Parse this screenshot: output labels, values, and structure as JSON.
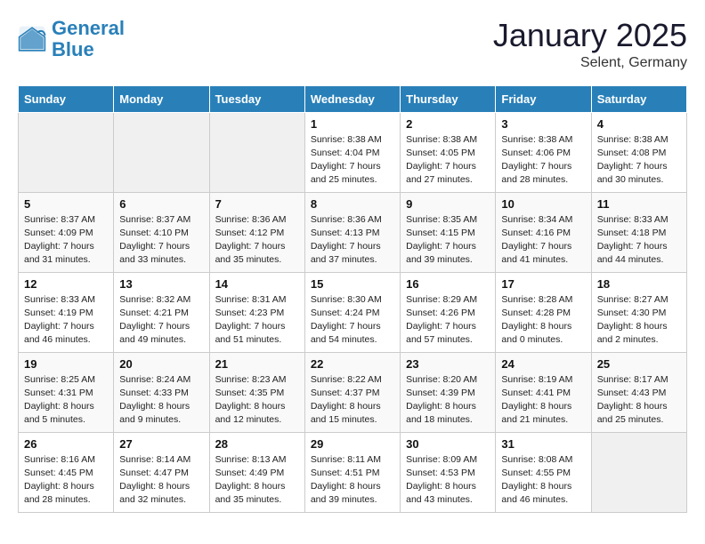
{
  "header": {
    "logo_general": "General",
    "logo_blue": "Blue",
    "title": "January 2025",
    "subtitle": "Selent, Germany"
  },
  "weekdays": [
    "Sunday",
    "Monday",
    "Tuesday",
    "Wednesday",
    "Thursday",
    "Friday",
    "Saturday"
  ],
  "weeks": [
    [
      {
        "day": "",
        "info": ""
      },
      {
        "day": "",
        "info": ""
      },
      {
        "day": "",
        "info": ""
      },
      {
        "day": "1",
        "info": "Sunrise: 8:38 AM\nSunset: 4:04 PM\nDaylight: 7 hours\nand 25 minutes."
      },
      {
        "day": "2",
        "info": "Sunrise: 8:38 AM\nSunset: 4:05 PM\nDaylight: 7 hours\nand 27 minutes."
      },
      {
        "day": "3",
        "info": "Sunrise: 8:38 AM\nSunset: 4:06 PM\nDaylight: 7 hours\nand 28 minutes."
      },
      {
        "day": "4",
        "info": "Sunrise: 8:38 AM\nSunset: 4:08 PM\nDaylight: 7 hours\nand 30 minutes."
      }
    ],
    [
      {
        "day": "5",
        "info": "Sunrise: 8:37 AM\nSunset: 4:09 PM\nDaylight: 7 hours\nand 31 minutes."
      },
      {
        "day": "6",
        "info": "Sunrise: 8:37 AM\nSunset: 4:10 PM\nDaylight: 7 hours\nand 33 minutes."
      },
      {
        "day": "7",
        "info": "Sunrise: 8:36 AM\nSunset: 4:12 PM\nDaylight: 7 hours\nand 35 minutes."
      },
      {
        "day": "8",
        "info": "Sunrise: 8:36 AM\nSunset: 4:13 PM\nDaylight: 7 hours\nand 37 minutes."
      },
      {
        "day": "9",
        "info": "Sunrise: 8:35 AM\nSunset: 4:15 PM\nDaylight: 7 hours\nand 39 minutes."
      },
      {
        "day": "10",
        "info": "Sunrise: 8:34 AM\nSunset: 4:16 PM\nDaylight: 7 hours\nand 41 minutes."
      },
      {
        "day": "11",
        "info": "Sunrise: 8:33 AM\nSunset: 4:18 PM\nDaylight: 7 hours\nand 44 minutes."
      }
    ],
    [
      {
        "day": "12",
        "info": "Sunrise: 8:33 AM\nSunset: 4:19 PM\nDaylight: 7 hours\nand 46 minutes."
      },
      {
        "day": "13",
        "info": "Sunrise: 8:32 AM\nSunset: 4:21 PM\nDaylight: 7 hours\nand 49 minutes."
      },
      {
        "day": "14",
        "info": "Sunrise: 8:31 AM\nSunset: 4:23 PM\nDaylight: 7 hours\nand 51 minutes."
      },
      {
        "day": "15",
        "info": "Sunrise: 8:30 AM\nSunset: 4:24 PM\nDaylight: 7 hours\nand 54 minutes."
      },
      {
        "day": "16",
        "info": "Sunrise: 8:29 AM\nSunset: 4:26 PM\nDaylight: 7 hours\nand 57 minutes."
      },
      {
        "day": "17",
        "info": "Sunrise: 8:28 AM\nSunset: 4:28 PM\nDaylight: 8 hours\nand 0 minutes."
      },
      {
        "day": "18",
        "info": "Sunrise: 8:27 AM\nSunset: 4:30 PM\nDaylight: 8 hours\nand 2 minutes."
      }
    ],
    [
      {
        "day": "19",
        "info": "Sunrise: 8:25 AM\nSunset: 4:31 PM\nDaylight: 8 hours\nand 5 minutes."
      },
      {
        "day": "20",
        "info": "Sunrise: 8:24 AM\nSunset: 4:33 PM\nDaylight: 8 hours\nand 9 minutes."
      },
      {
        "day": "21",
        "info": "Sunrise: 8:23 AM\nSunset: 4:35 PM\nDaylight: 8 hours\nand 12 minutes."
      },
      {
        "day": "22",
        "info": "Sunrise: 8:22 AM\nSunset: 4:37 PM\nDaylight: 8 hours\nand 15 minutes."
      },
      {
        "day": "23",
        "info": "Sunrise: 8:20 AM\nSunset: 4:39 PM\nDaylight: 8 hours\nand 18 minutes."
      },
      {
        "day": "24",
        "info": "Sunrise: 8:19 AM\nSunset: 4:41 PM\nDaylight: 8 hours\nand 21 minutes."
      },
      {
        "day": "25",
        "info": "Sunrise: 8:17 AM\nSunset: 4:43 PM\nDaylight: 8 hours\nand 25 minutes."
      }
    ],
    [
      {
        "day": "26",
        "info": "Sunrise: 8:16 AM\nSunset: 4:45 PM\nDaylight: 8 hours\nand 28 minutes."
      },
      {
        "day": "27",
        "info": "Sunrise: 8:14 AM\nSunset: 4:47 PM\nDaylight: 8 hours\nand 32 minutes."
      },
      {
        "day": "28",
        "info": "Sunrise: 8:13 AM\nSunset: 4:49 PM\nDaylight: 8 hours\nand 35 minutes."
      },
      {
        "day": "29",
        "info": "Sunrise: 8:11 AM\nSunset: 4:51 PM\nDaylight: 8 hours\nand 39 minutes."
      },
      {
        "day": "30",
        "info": "Sunrise: 8:09 AM\nSunset: 4:53 PM\nDaylight: 8 hours\nand 43 minutes."
      },
      {
        "day": "31",
        "info": "Sunrise: 8:08 AM\nSunset: 4:55 PM\nDaylight: 8 hours\nand 46 minutes."
      },
      {
        "day": "",
        "info": ""
      }
    ]
  ]
}
